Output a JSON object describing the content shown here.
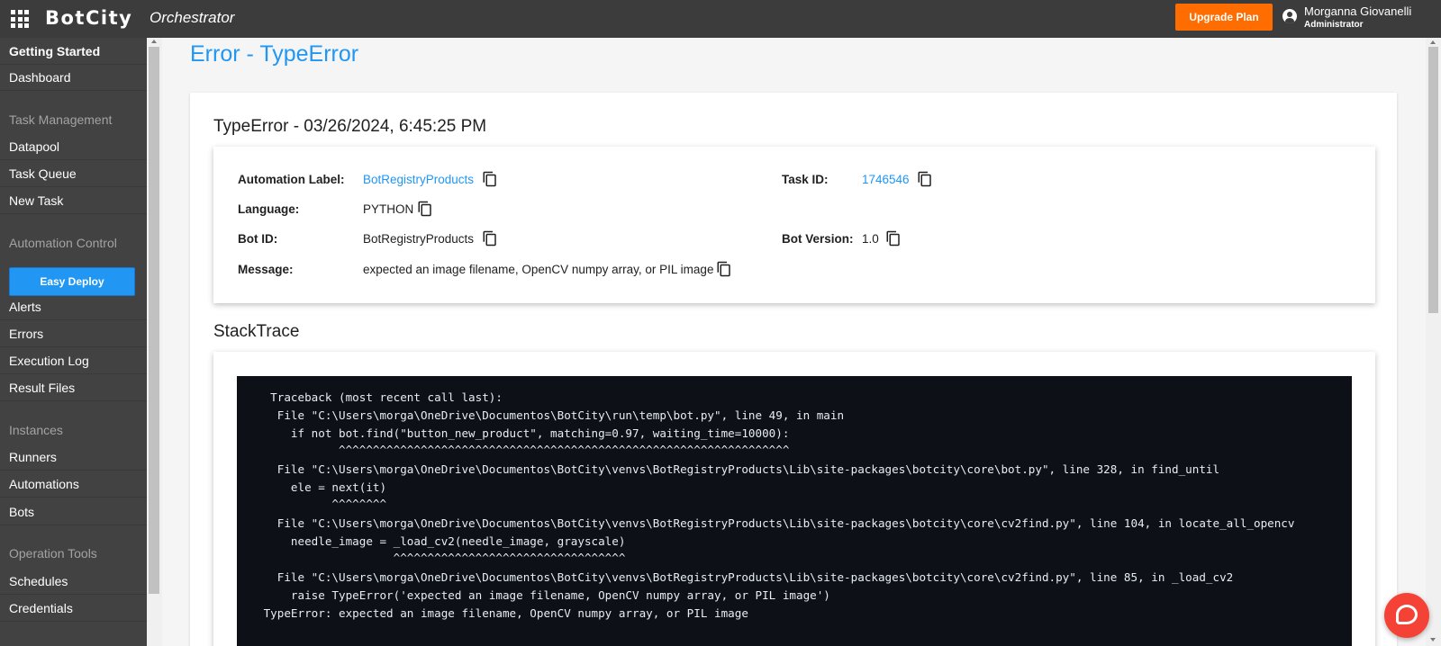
{
  "app": {
    "brand": "BotCity",
    "product": "Orchestrator",
    "upgrade_label": "Upgrade Plan",
    "user_name": "Morganna Giovanelli",
    "user_role": "Administrator"
  },
  "sidebar": {
    "items": [
      {
        "label": "Getting Started"
      },
      {
        "label": "Dashboard"
      },
      {
        "label": "Task Management"
      },
      {
        "label": "Datapool"
      },
      {
        "label": "Task Queue"
      },
      {
        "label": "New Task"
      },
      {
        "label": "Automation Control"
      },
      {
        "label": "Easy Deploy"
      },
      {
        "label": "Alerts"
      },
      {
        "label": "Errors"
      },
      {
        "label": "Execution Log"
      },
      {
        "label": "Result Files"
      },
      {
        "label": "Instances"
      },
      {
        "label": "Runners"
      },
      {
        "label": "Automations"
      },
      {
        "label": "Bots"
      },
      {
        "label": "Operation Tools"
      },
      {
        "label": "Schedules"
      },
      {
        "label": "Credentials"
      }
    ]
  },
  "page": {
    "title": "Error - TypeError",
    "error_header": "TypeError - 03/26/2024, 6:45:25 PM",
    "details": {
      "automation_label": {
        "label": "Automation Label:",
        "value": "BotRegistryProducts"
      },
      "task_id": {
        "label": "Task ID:",
        "value": "1746546"
      },
      "language": {
        "label": "Language:",
        "value": "PYTHON"
      },
      "bot_id": {
        "label": "Bot ID:",
        "value": "BotRegistryProducts"
      },
      "bot_version": {
        "label": "Bot Version:",
        "value": "1.0"
      },
      "message": {
        "label": "Message:",
        "value": "expected an image filename, OpenCV numpy array, or PIL image"
      }
    },
    "stacktrace_title": "StackTrace",
    "stacktrace_lines": [
      "  Traceback (most recent call last):",
      "   File \"C:\\Users\\morga\\OneDrive\\Documentos\\BotCity\\run\\temp\\bot.py\", line 49, in main",
      "     if not bot.find(\"button_new_product\", matching=0.97, waiting_time=10000):",
      "            ^^^^^^^^^^^^^^^^^^^^^^^^^^^^^^^^^^^^^^^^^^^^^^^^^^^^^^^^^^^^^^^^^^",
      "   File \"C:\\Users\\morga\\OneDrive\\Documentos\\BotCity\\venvs\\BotRegistryProducts\\Lib\\site-packages\\botcity\\core\\bot.py\", line 328, in find_until",
      "     ele = next(it)",
      "           ^^^^^^^^",
      "   File \"C:\\Users\\morga\\OneDrive\\Documentos\\BotCity\\venvs\\BotRegistryProducts\\Lib\\site-packages\\botcity\\core\\cv2find.py\", line 104, in locate_all_opencv",
      "     needle_image = _load_cv2(needle_image, grayscale)",
      "                    ^^^^^^^^^^^^^^^^^^^^^^^^^^^^^^^^^^",
      "   File \"C:\\Users\\morga\\OneDrive\\Documentos\\BotCity\\venvs\\BotRegistryProducts\\Lib\\site-packages\\botcity\\core\\cv2find.py\", line 85, in _load_cv2",
      "     raise TypeError('expected an image filename, OpenCV numpy array, or PIL image')",
      " TypeError: expected an image filename, OpenCV numpy array, or PIL image"
    ]
  },
  "colors": {
    "accent": "#2196f3",
    "upgrade": "#ff6d00",
    "topbar": "#3c3c3c",
    "sidebar": "#424242",
    "code_bg": "#0d1117"
  }
}
